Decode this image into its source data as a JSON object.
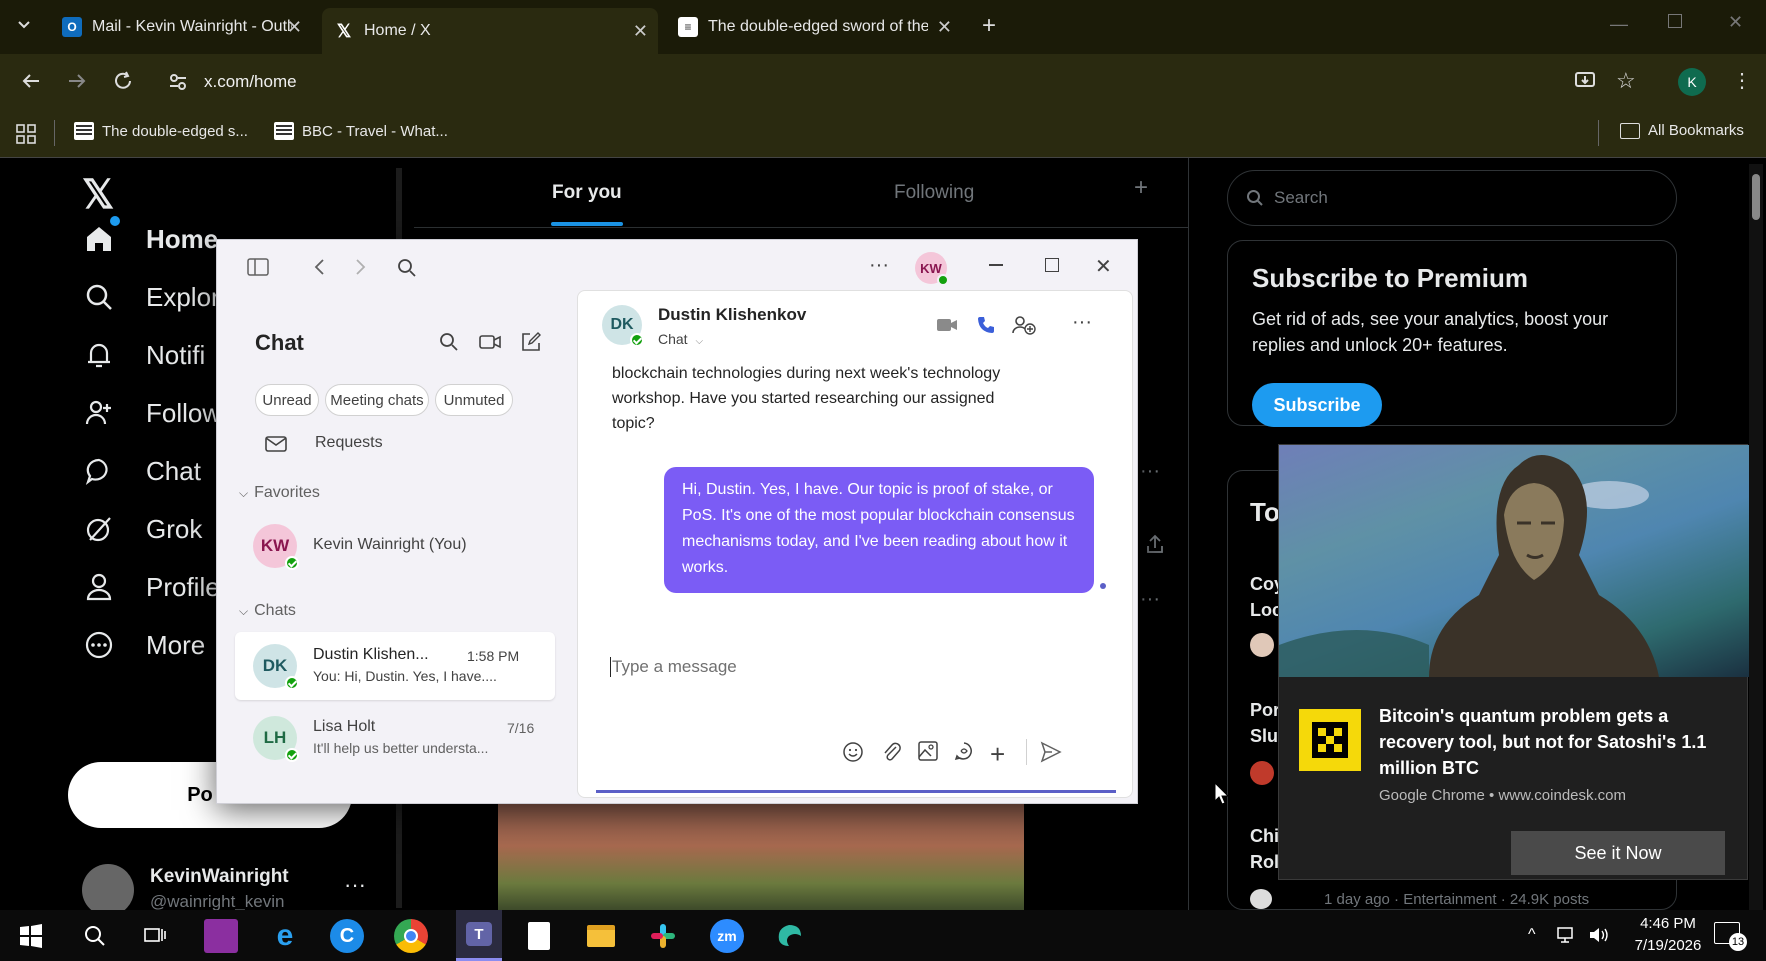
{
  "browser": {
    "tabs": [
      {
        "title": "Mail - Kevin Wainright - Outloo",
        "icon": "outlook-icon"
      },
      {
        "title": "Home / X",
        "icon": "x-logo-icon"
      },
      {
        "title": "The double-edged sword of the",
        "icon": "article-icon"
      }
    ],
    "url": "x.com/home",
    "profile_initial": "K",
    "bookmarks": [
      {
        "label": "The double-edged s..."
      },
      {
        "label": "BBC - Travel - What..."
      }
    ],
    "all_bookmarks": "All Bookmarks"
  },
  "x": {
    "nav": [
      {
        "label": "Home",
        "icon": "home-icon"
      },
      {
        "label": "Explor",
        "icon": "search-icon"
      },
      {
        "label": "Notifi",
        "icon": "bell-icon"
      },
      {
        "label": "Follow",
        "icon": "follow-icon"
      },
      {
        "label": "Chat",
        "icon": "chat-icon"
      },
      {
        "label": "Grok",
        "icon": "grok-icon"
      },
      {
        "label": "Profile",
        "icon": "profile-icon"
      },
      {
        "label": "More",
        "icon": "more-icon"
      }
    ],
    "post_button": "Po",
    "user_name": "KevinWainright",
    "user_handle": "@wainright_kevin",
    "tab_foryou": "For you",
    "tab_following": "Following",
    "search_placeholder": "Search",
    "premium_title": "Subscribe to Premium",
    "premium_text": "Get rid of ads, see your analytics, boost your replies and unlock 20+ features.",
    "subscribe_label": "Subscribe",
    "trending_heading": "To",
    "trend_frag_1a": "Coy",
    "trend_frag_1b": "Loc",
    "trend_frag_2a": "Por",
    "trend_frag_2b": "Slu",
    "trend_frag_3a": "Chi",
    "trend_frag_3b": "Rol",
    "trend_meta": "1 day ago · Entertainment · 24.9K posts"
  },
  "teams": {
    "owner_initials": "KW",
    "chat_title": "Chat",
    "filters": [
      "Unread",
      "Meeting chats",
      "Unmuted"
    ],
    "requests": "Requests",
    "favorites_label": "Favorites",
    "favorite_name": "Kevin Wainright (You)",
    "favorite_initials": "KW",
    "chats_label": "Chats",
    "chats": [
      {
        "initials": "DK",
        "name": "Dustin Klishen...",
        "time": "1:58 PM",
        "preview": "You: Hi, Dustin. Yes, I have...."
      },
      {
        "initials": "LH",
        "name": "Lisa Holt",
        "time": "7/16",
        "preview": "It'll help us better understa..."
      }
    ],
    "conv_initials": "DK",
    "conv_name": "Dustin Klishenkov",
    "conv_sub": "Chat",
    "incoming_message": "blockchain technologies during next week's technology workshop. Have you started researching our assigned topic?",
    "outgoing_message": "Hi, Dustin. Yes, I have. Our topic is proof of stake, or PoS. It's one of the most popular blockchain consensus mechanisms today, and I've been reading about how it works.",
    "compose_placeholder": "Type a message",
    "accent": "#7b5cf5"
  },
  "notification": {
    "title": "Bitcoin's quantum problem gets a recovery tool, but not for Satoshi's 1.1 million BTC",
    "source": "Google Chrome • www.coindesk.com",
    "action": "See it Now"
  },
  "taskbar": {
    "time": "4:46 PM",
    "date": "7/19/2026",
    "notif_count": "13"
  }
}
